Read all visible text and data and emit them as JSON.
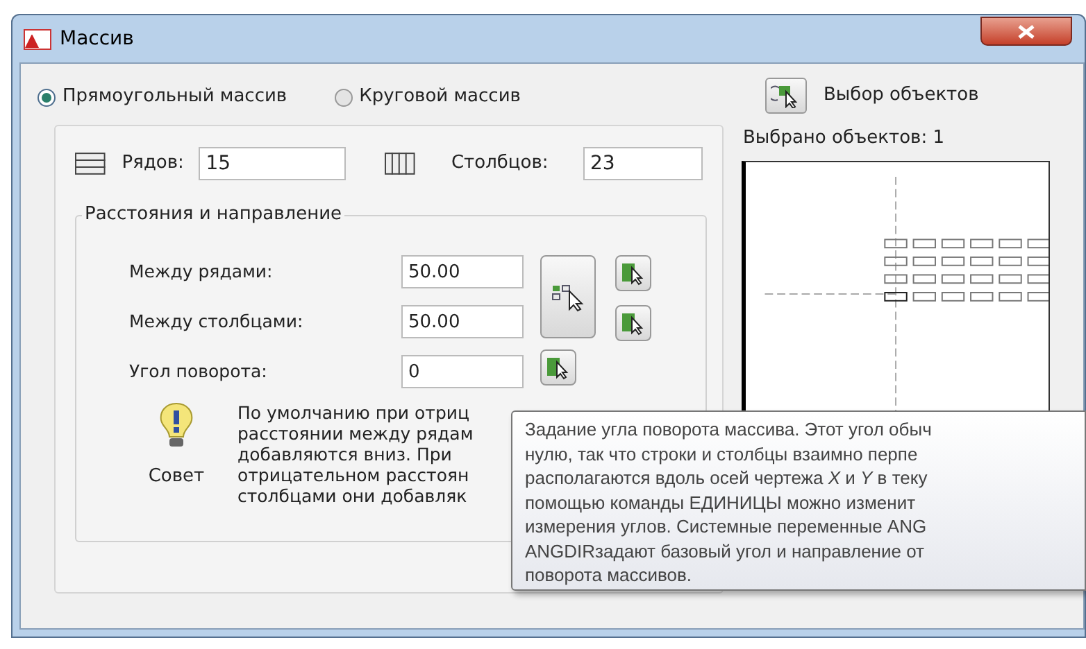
{
  "window": {
    "title": "Массив"
  },
  "array_type": [
    {
      "label": "Прямоугольный массив",
      "selected": true
    },
    {
      "label": "Круговой массив",
      "selected": false
    }
  ],
  "select_objects": {
    "label": "Выбор объектов"
  },
  "selected_count": "Выбрано объектов: 1",
  "rows": {
    "label": "Рядов:",
    "value": "15"
  },
  "columns": {
    "label": "Столбцов:",
    "value": "23"
  },
  "distances": {
    "title": "Расстояния и направление",
    "fields": [
      {
        "label": "Между рядами:",
        "value": "50.00"
      },
      {
        "label": "Между столбцами:",
        "value": "50.00"
      },
      {
        "label": "Угол поворота:",
        "value": "0"
      }
    ]
  },
  "tip": {
    "label": "Совет",
    "text": "По умолчанию при отриц\nрасстоянии между рядам\nдобавляются вниз. При\nотрицательном расстоян\nстолбцами они добавляк"
  },
  "tooltip": {
    "text": "Задание угла поворота массива. Этот угол обыч\nнулю, так что строки и столбцы взаимно перпе\nрасполагаются вдоль осей чертежа *X* и *Y* в теку\nпомощью команды ЕДИНИЦЫ можно изменит\nизмерения углов. Системные переменные ANG\nANGDIRзадают базовый угол и направление от\nповорота массивов."
  }
}
